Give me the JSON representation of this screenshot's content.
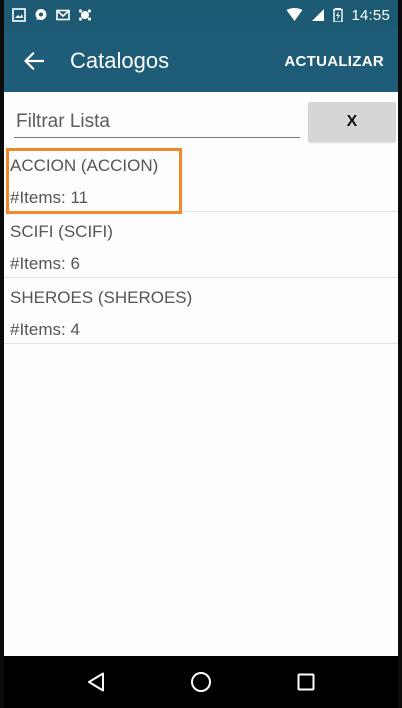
{
  "status_bar": {
    "time": "14:55",
    "left_icons": [
      "image-icon",
      "chat-icon",
      "mail-icon",
      "android-icon"
    ],
    "right_icons": [
      "wifi-icon",
      "signal-icon",
      "battery-charging-icon"
    ]
  },
  "app_bar": {
    "title": "Catalogos",
    "action_label": "ACTUALIZAR",
    "back_icon": "arrow-left-icon",
    "background": "#1e5c78"
  },
  "filter": {
    "placeholder": "Filtrar Lista",
    "value": "",
    "clear_label": "X"
  },
  "catalogs": [
    {
      "name": "ACCION (ACCION)",
      "count": "#Items: 11",
      "highlighted": true
    },
    {
      "name": "SCIFI (SCIFI)",
      "count": "#Items: 6",
      "highlighted": false
    },
    {
      "name": "SHEROES (SHEROES)",
      "count": "#Items: 4",
      "highlighted": false
    }
  ],
  "nav_bar": {
    "buttons": [
      "back-triangle-icon",
      "home-circle-icon",
      "recents-square-icon"
    ]
  },
  "colors": {
    "status_bar": "#1c5a73",
    "highlight": "#ef8a2c",
    "clear_button": "#d6d6d6"
  }
}
